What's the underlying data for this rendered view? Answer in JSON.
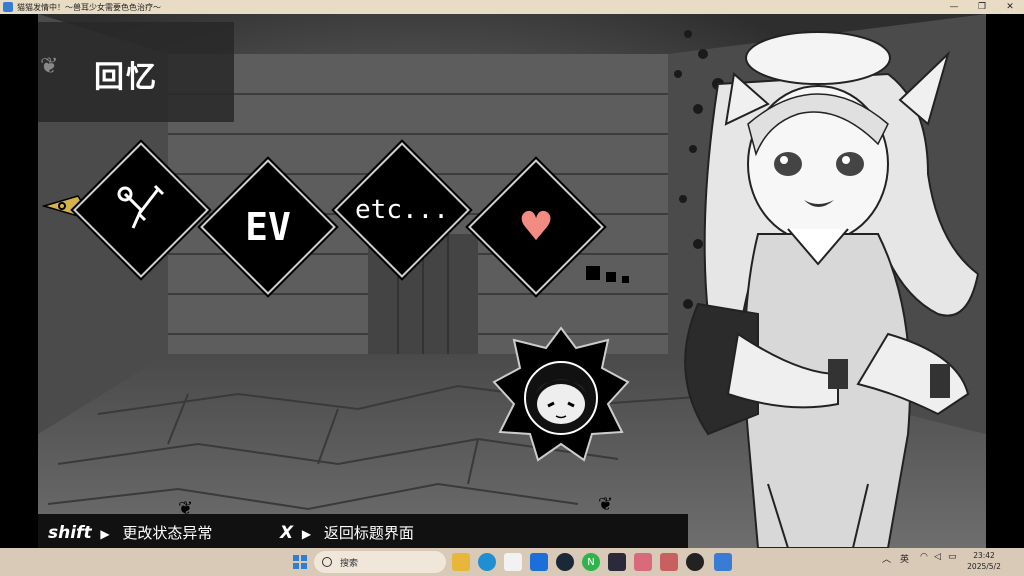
{
  "window": {
    "title": "猫猫发情中！～兽耳少女需要色色治疗～",
    "minimize": "—",
    "maximize": "❐",
    "close": "✕"
  },
  "menu": {
    "title": "回忆",
    "items": [
      {
        "name": "cg",
        "label": ""
      },
      {
        "name": "ev",
        "label": "EV"
      },
      {
        "name": "etc",
        "label": "etc..."
      },
      {
        "name": "heart",
        "label": "♥"
      }
    ]
  },
  "hints": {
    "shift_key": "shift",
    "shift_action": "更改状态异常",
    "x_key": "X",
    "x_action": "返回标题界面",
    "arrow": "▶"
  },
  "taskbar": {
    "search_placeholder": "搜索",
    "ime": "英",
    "time": "23:42",
    "date": "2025/5/2"
  },
  "colors": {
    "titlebar": "#e9dcc4",
    "taskbar": "#d9c9b7",
    "heart": "#f28b82",
    "cursor": "#d4b24a"
  }
}
